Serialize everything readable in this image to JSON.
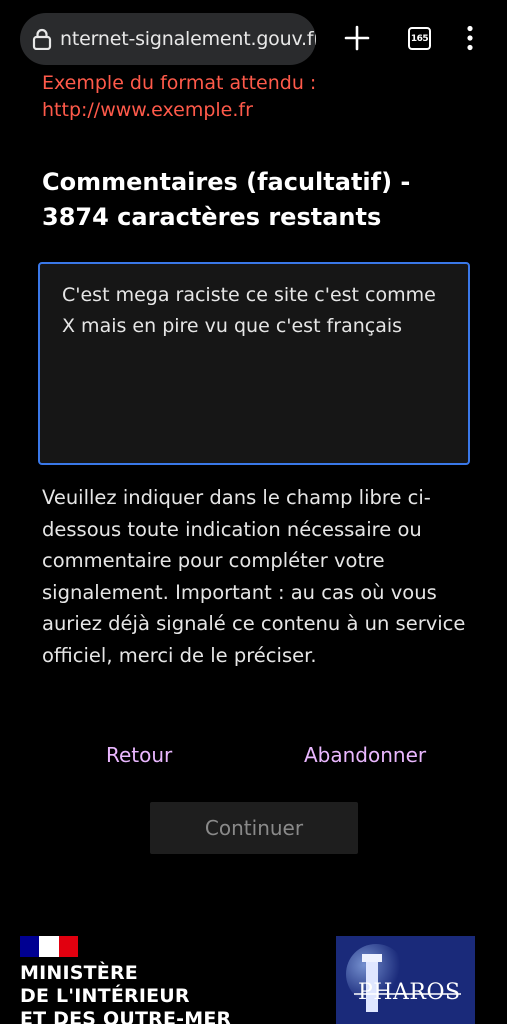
{
  "browser": {
    "url_text": "nternet-signalement.gouv.fr",
    "tab_count": "165"
  },
  "form": {
    "url_hint_line1": "Exemple du format attendu :",
    "url_hint_line2": "http://www.exemple.fr",
    "comments_title": "Commentaires (facultatif) - 3874 caractères restants",
    "comments_value": "C'est mega raciste ce site c'est comme X mais en pire vu que c'est français",
    "help_text": "Veuillez indiquer dans le champ libre ci-dessous toute indication nécessaire ou commentaire pour compléter votre signalement. Important : au cas où vous auriez déjà signalé ce contenu à un service officiel, merci de le préciser."
  },
  "actions": {
    "back_label": "Retour",
    "abandon_label": "Abandonner",
    "continue_label": "Continuer"
  },
  "footer": {
    "ministry_line1": "MINISTÈRE",
    "ministry_line2": "DE L'INTÉRIEUR",
    "ministry_line3": "ET DES OUTRE-MER",
    "pharos_logo_text": "PHAROS"
  },
  "colors": {
    "hint": "#ff5a4a",
    "textarea_border": "#3a78e8",
    "link": "#eab8ff",
    "flag_blue": "#000091",
    "flag_red": "#e1000f"
  },
  "icons": [
    "lock-icon",
    "plus-icon",
    "tabs-icon",
    "more-vert-icon",
    "marianne-flag-logo",
    "pharos-logo"
  ]
}
